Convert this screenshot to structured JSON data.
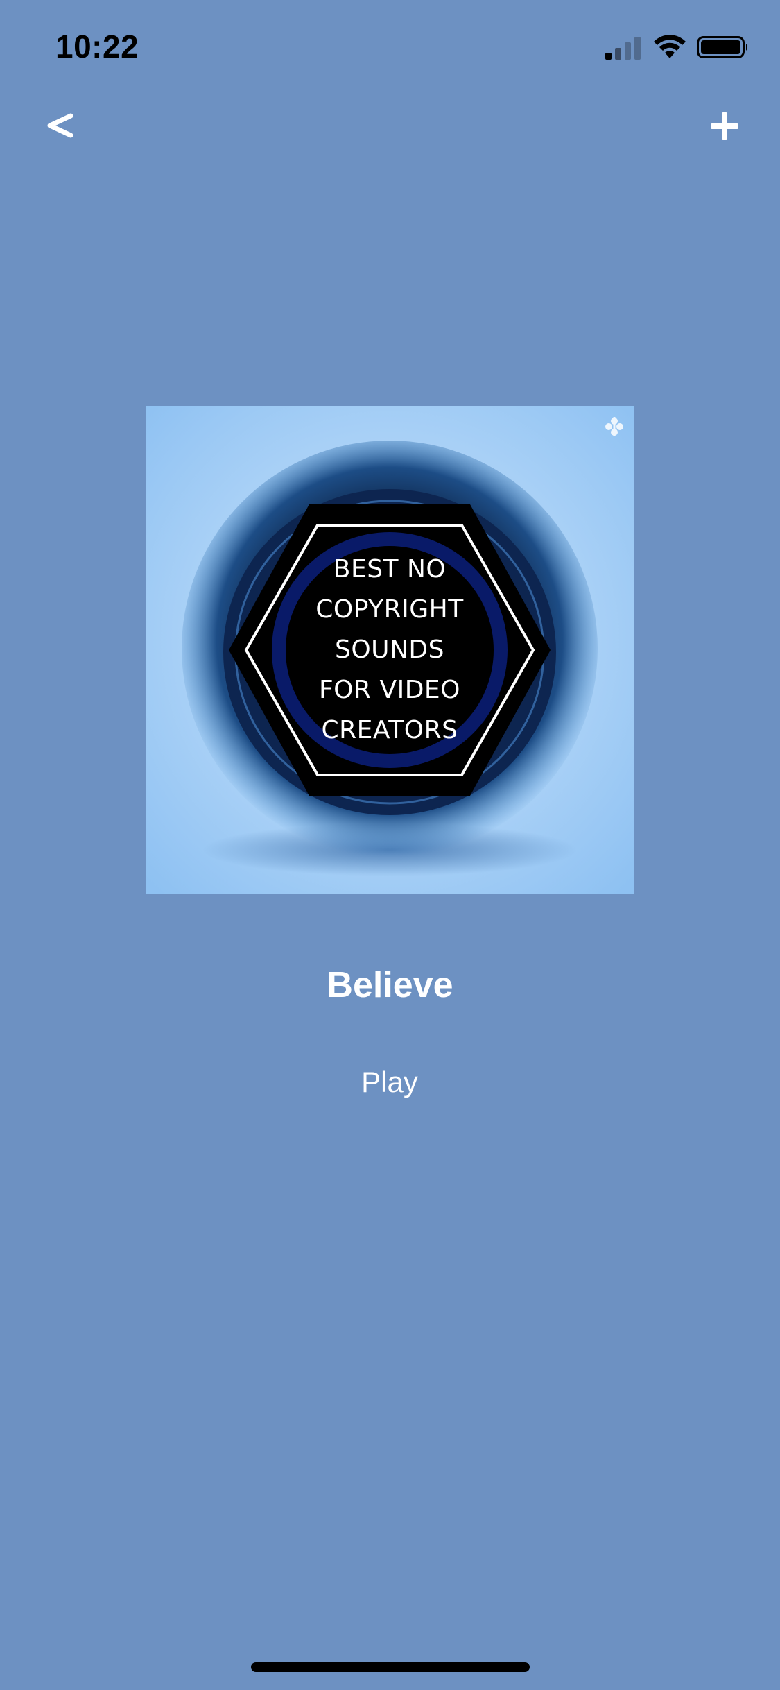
{
  "status_bar": {
    "time": "10:22"
  },
  "nav": {
    "back_label": "<",
    "add_label": "+"
  },
  "artwork": {
    "lines": [
      "BEST NO",
      "COPYRIGHT",
      "SOUNDS",
      "FOR VIDEO",
      "CREATORS"
    ]
  },
  "track": {
    "title": "Believe",
    "play_label": "Play"
  },
  "colors": {
    "background": "#6D91C2",
    "text": "#ffffff",
    "status_text": "#000000"
  },
  "icons": {
    "signal": "cellular-signal-icon",
    "wifi": "wifi-icon",
    "battery": "battery-icon",
    "back": "back-chevron-icon",
    "add": "plus-icon",
    "logo": "fleur-de-lis-icon"
  }
}
